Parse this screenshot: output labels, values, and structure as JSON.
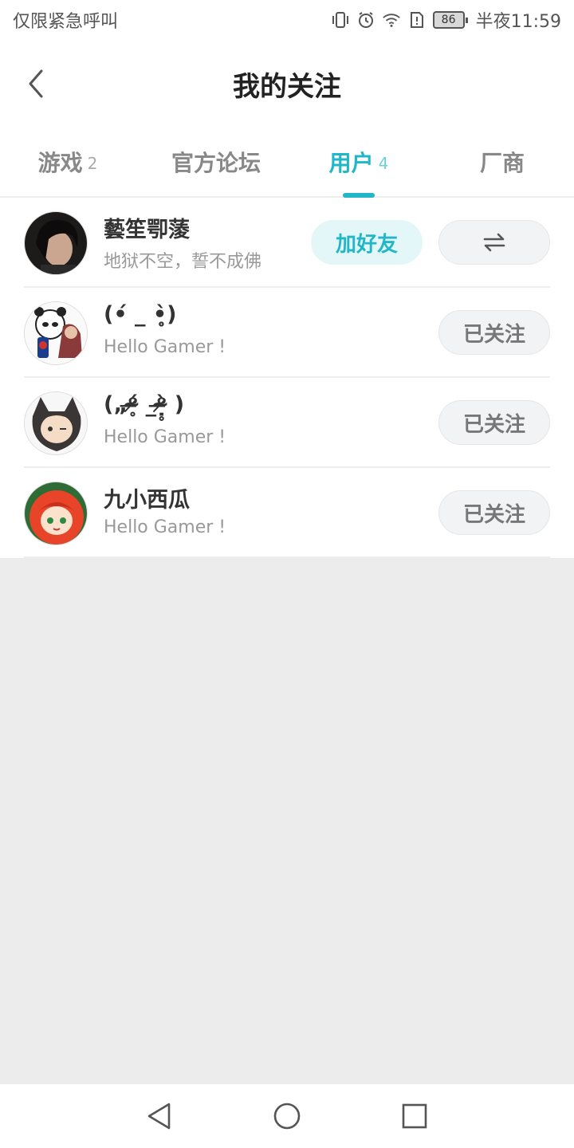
{
  "status_bar": {
    "carrier": "仅限紧急呼叫",
    "battery": "86",
    "time": "半夜11:59",
    "icons": [
      "vibrate-icon",
      "alarm-icon",
      "wifi-icon",
      "sim-alert-icon",
      "battery-icon"
    ]
  },
  "header": {
    "title": "我的关注",
    "back_icon": "back-chevron-icon"
  },
  "tabs": [
    {
      "label": "游戏",
      "count": "2"
    },
    {
      "label": "官方论坛",
      "count": ""
    },
    {
      "label": "用户",
      "count": "4",
      "active": true
    },
    {
      "label": "厂商",
      "count": ""
    }
  ],
  "users": [
    {
      "name": "藝笙卾蔆",
      "bio": "地狱不空，誓不成佛",
      "add_friend_label": "加好友",
      "swap_icon": "swap-arrows-icon"
    },
    {
      "name": "(•́ _ •̥̥̥̀)",
      "bio": "Hello Gamer !",
      "follow_label": "已关注"
    },
    {
      "name": "(„ᵒ̴̶̷̥́ _ᵒ̴̶̷̣̥̀ )",
      "bio": "Hello Gamer !",
      "follow_label": "已关注"
    },
    {
      "name": "九小西瓜",
      "bio": "Hello Gamer !",
      "follow_label": "已关注"
    }
  ],
  "accent_color": "#22b7c8",
  "nav": {
    "icons": [
      "nav-back-icon",
      "nav-home-icon",
      "nav-recents-icon"
    ]
  }
}
